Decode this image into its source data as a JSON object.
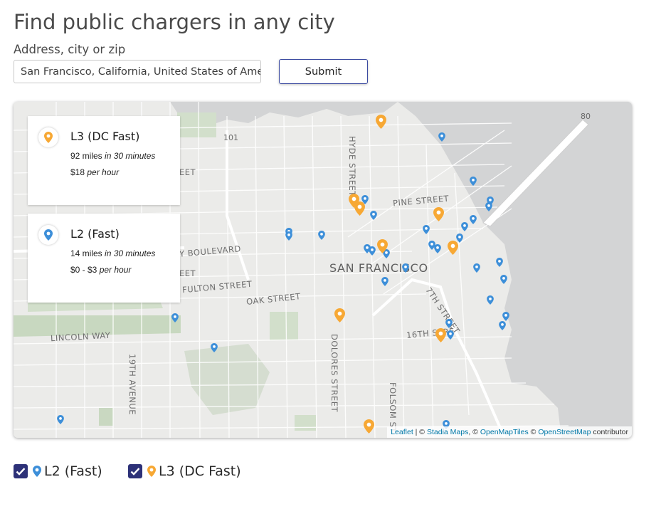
{
  "page_title": "Find public chargers in any city",
  "address": {
    "label": "Address, city or zip",
    "value": "San Francisco, California, United States of America"
  },
  "submit_label": "Submit",
  "colors": {
    "l2_pin": "#3d8fd9",
    "l3_pin": "#f7a834",
    "checkbox": "#2d3178"
  },
  "map": {
    "city_label": "SAN FRANCISCO",
    "highway_shields": [
      "101",
      "80"
    ],
    "street_labels": [
      "HYDE STREET",
      "PINE STREET",
      "Y BOULEVARD",
      "EET",
      "FULTON STREET",
      "OAK STREET",
      "7TH STREET",
      "16TH STRE",
      "LINCOLN WAY",
      "DOLORES STREET",
      "19TH AVENUE",
      "FOLSOM ST",
      "EET"
    ],
    "attribution": {
      "leaflet": "Leaflet",
      "sep1": " | © ",
      "stadia": "Stadia Maps",
      "sep2": ", © ",
      "openmaptiles": "OpenMapTiles",
      "sep3": " © ",
      "osm": "OpenStreetMap",
      "suffix": " contributor"
    }
  },
  "chargers": [
    {
      "name": "L3 (DC Fast)",
      "range_value": "92 miles",
      "range_suffix": "in 30 minutes",
      "price_value": "$18",
      "price_suffix": "per hour",
      "icon": "map-pin-orange"
    },
    {
      "name": "L2 (Fast)",
      "range_value": "14 miles",
      "range_suffix": "in 30 minutes",
      "price_value": "$0 - $3",
      "price_suffix": "per hour",
      "icon": "map-pin-blue"
    }
  ],
  "filters": [
    {
      "label": "L2 (Fast)",
      "checked": true,
      "icon": "map-pin-blue"
    },
    {
      "label": "L3 (DC Fast)",
      "checked": true,
      "icon": "map-pin-orange"
    }
  ]
}
